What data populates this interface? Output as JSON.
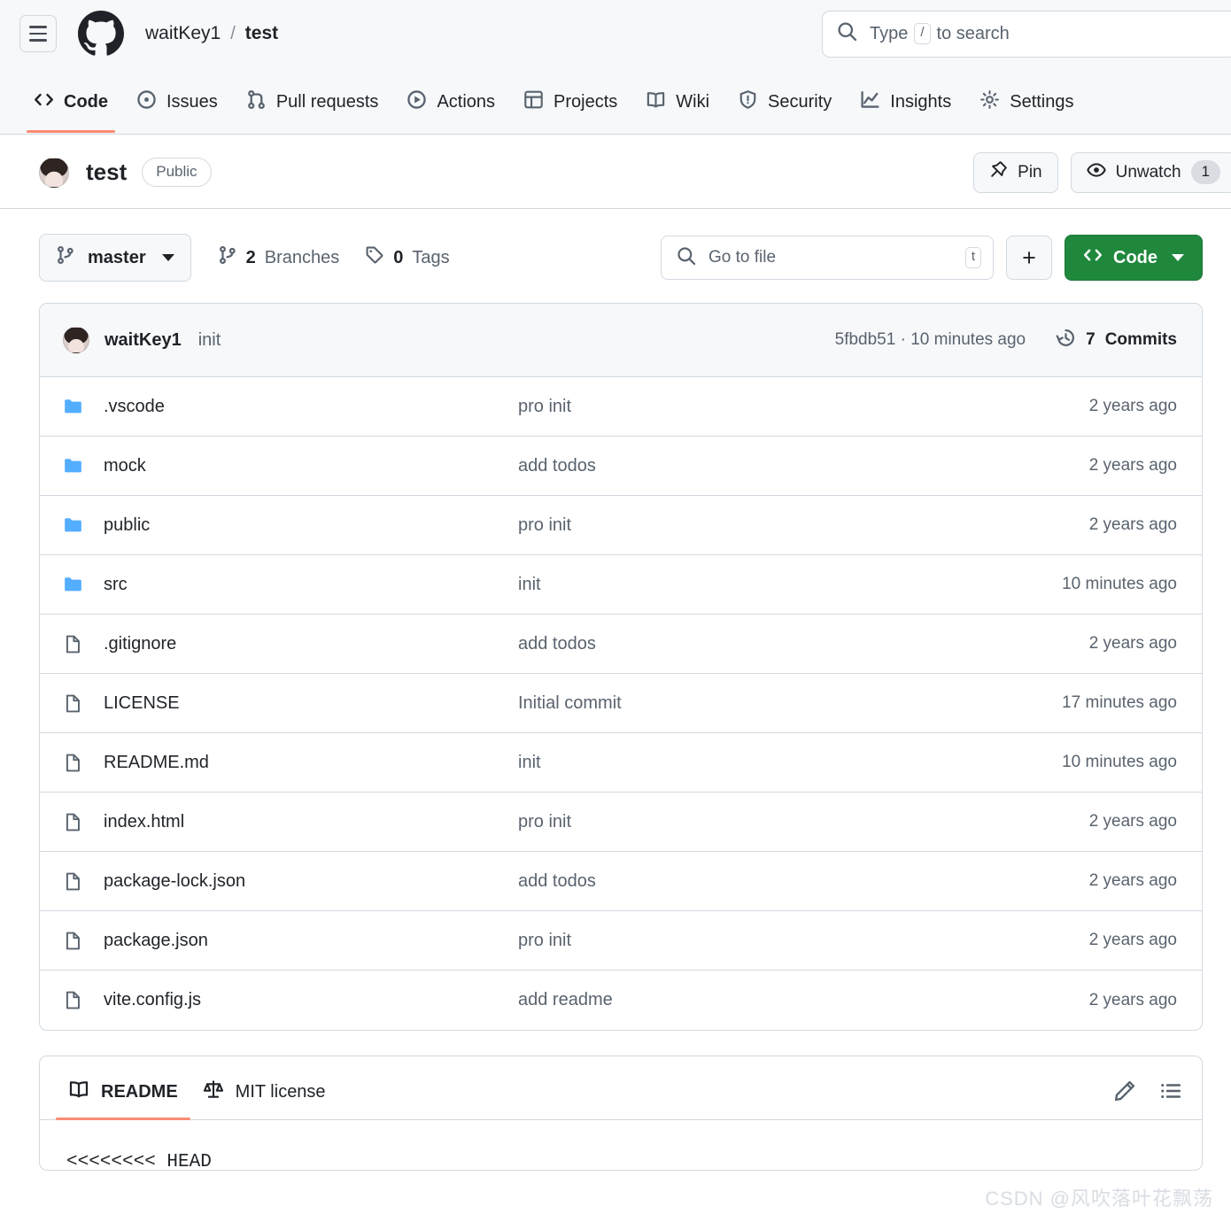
{
  "header": {
    "menu_icon": "hamburger-icon",
    "logo_icon": "github-mark-icon",
    "owner": "waitKey1",
    "separator": "/",
    "repo": "test",
    "search": {
      "icon": "search-icon",
      "placeholder_prefix": "Type",
      "shortcut": "/",
      "placeholder_suffix": "to search"
    }
  },
  "nav": {
    "tabs": [
      {
        "label": "Code",
        "icon": "code-icon",
        "active": true
      },
      {
        "label": "Issues",
        "icon": "issue-opened-icon",
        "active": false
      },
      {
        "label": "Pull requests",
        "icon": "git-pull-request-icon",
        "active": false
      },
      {
        "label": "Actions",
        "icon": "play-icon",
        "active": false
      },
      {
        "label": "Projects",
        "icon": "table-icon",
        "active": false
      },
      {
        "label": "Wiki",
        "icon": "book-icon",
        "active": false
      },
      {
        "label": "Security",
        "icon": "shield-icon",
        "active": false
      },
      {
        "label": "Insights",
        "icon": "graph-icon",
        "active": false
      },
      {
        "label": "Settings",
        "icon": "gear-icon",
        "active": false
      }
    ]
  },
  "repo_header": {
    "avatar_icon": "owner-avatar",
    "name": "test",
    "visibility": "Public",
    "pin_label": "Pin",
    "pin_icon": "pin-icon",
    "watch_label": "Unwatch",
    "watch_icon": "eye-icon",
    "watch_count": "1"
  },
  "toolbar": {
    "branch": "master",
    "branch_icon": "git-branch-icon",
    "branches_count": "2",
    "branches_label": "Branches",
    "tags_count": "0",
    "tags_label": "Tags",
    "tag_icon": "tag-icon",
    "file_search_placeholder": "Go to file",
    "file_search_shortcut": "t",
    "add_label": "+",
    "code_label": "Code",
    "code_icon": "code-icon"
  },
  "latest_commit": {
    "avatar_icon": "commit-author-avatar",
    "author": "waitKey1",
    "message": "init",
    "hash": "5fbdb51",
    "separator": "·",
    "relative_time": "10 minutes ago",
    "history_icon": "history-icon",
    "commits_count": "7",
    "commits_label": "Commits"
  },
  "files": [
    {
      "name": ".vscode",
      "type": "dir",
      "message": "pro init",
      "time": "2 years ago"
    },
    {
      "name": "mock",
      "type": "dir",
      "message": "add todos",
      "time": "2 years ago"
    },
    {
      "name": "public",
      "type": "dir",
      "message": "pro init",
      "time": "2 years ago"
    },
    {
      "name": "src",
      "type": "dir",
      "message": "init",
      "time": "10 minutes ago"
    },
    {
      "name": ".gitignore",
      "type": "file",
      "message": "add todos",
      "time": "2 years ago"
    },
    {
      "name": "LICENSE",
      "type": "file",
      "message": "Initial commit",
      "time": "17 minutes ago"
    },
    {
      "name": "README.md",
      "type": "file",
      "message": "init",
      "time": "10 minutes ago"
    },
    {
      "name": "index.html",
      "type": "file",
      "message": "pro init",
      "time": "2 years ago"
    },
    {
      "name": "package-lock.json",
      "type": "file",
      "message": "add todos",
      "time": "2 years ago"
    },
    {
      "name": "package.json",
      "type": "file",
      "message": "pro init",
      "time": "2 years ago"
    },
    {
      "name": "vite.config.js",
      "type": "file",
      "message": "add readme",
      "time": "2 years ago"
    }
  ],
  "readme": {
    "tabs": [
      {
        "label": "README",
        "icon": "book-icon",
        "active": true
      },
      {
        "label": "MIT license",
        "icon": "law-icon",
        "active": false
      }
    ],
    "edit_icon": "pencil-icon",
    "outline_icon": "list-unordered-icon",
    "content_line": "<<<<<<<< HEAD"
  },
  "watermark": "CSDN @风吹落叶花飘荡",
  "colors": {
    "accent_green": "#1f883d",
    "tab_underline": "#fd8c73",
    "header_bg": "#f6f8fa",
    "border": "#d1d9e0",
    "folder_blue": "#54aeff",
    "muted_text": "#59636e"
  }
}
